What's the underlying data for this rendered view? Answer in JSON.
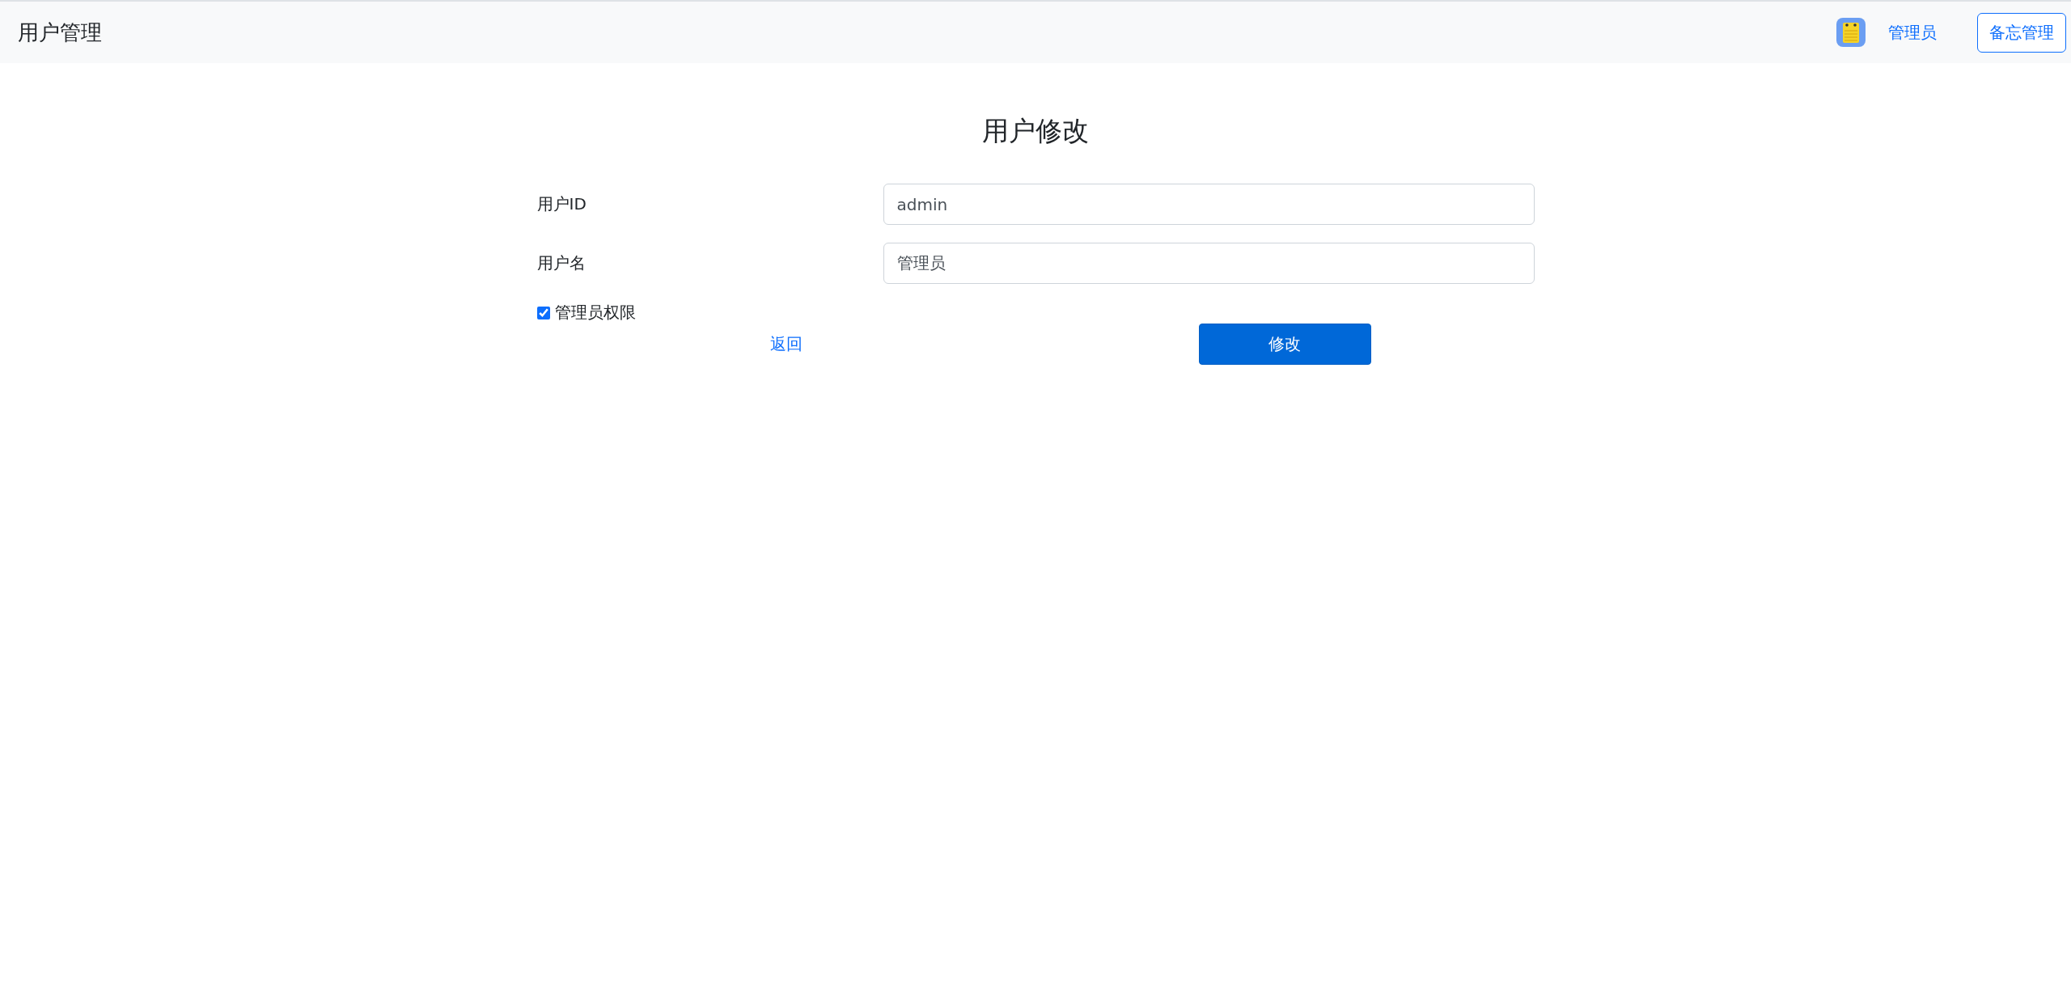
{
  "navbar": {
    "title": "用户管理",
    "user": "管理员",
    "button": "备忘管理"
  },
  "form": {
    "heading": "用户修改",
    "fields": [
      {
        "label": "用户ID",
        "value": "admin"
      },
      {
        "label": "用户名",
        "value": "管理员"
      }
    ],
    "checkbox": {
      "label": "管理员权限",
      "checked": true
    },
    "back_link": "返回",
    "submit": "修改"
  }
}
